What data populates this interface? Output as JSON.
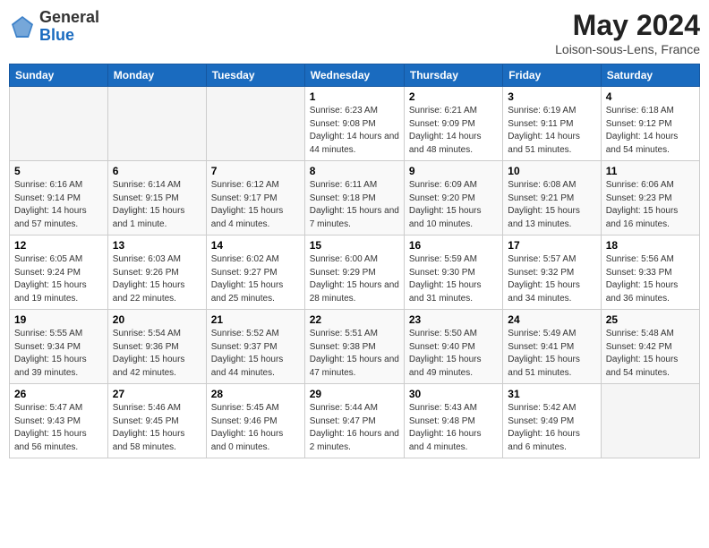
{
  "header": {
    "logo_general": "General",
    "logo_blue": "Blue",
    "month_title": "May 2024",
    "subtitle": "Loison-sous-Lens, France"
  },
  "weekdays": [
    "Sunday",
    "Monday",
    "Tuesday",
    "Wednesday",
    "Thursday",
    "Friday",
    "Saturday"
  ],
  "weeks": [
    [
      {
        "day": "",
        "info": ""
      },
      {
        "day": "",
        "info": ""
      },
      {
        "day": "",
        "info": ""
      },
      {
        "day": "1",
        "info": "Sunrise: 6:23 AM\nSunset: 9:08 PM\nDaylight: 14 hours and 44 minutes."
      },
      {
        "day": "2",
        "info": "Sunrise: 6:21 AM\nSunset: 9:09 PM\nDaylight: 14 hours and 48 minutes."
      },
      {
        "day": "3",
        "info": "Sunrise: 6:19 AM\nSunset: 9:11 PM\nDaylight: 14 hours and 51 minutes."
      },
      {
        "day": "4",
        "info": "Sunrise: 6:18 AM\nSunset: 9:12 PM\nDaylight: 14 hours and 54 minutes."
      }
    ],
    [
      {
        "day": "5",
        "info": "Sunrise: 6:16 AM\nSunset: 9:14 PM\nDaylight: 14 hours and 57 minutes."
      },
      {
        "day": "6",
        "info": "Sunrise: 6:14 AM\nSunset: 9:15 PM\nDaylight: 15 hours and 1 minute."
      },
      {
        "day": "7",
        "info": "Sunrise: 6:12 AM\nSunset: 9:17 PM\nDaylight: 15 hours and 4 minutes."
      },
      {
        "day": "8",
        "info": "Sunrise: 6:11 AM\nSunset: 9:18 PM\nDaylight: 15 hours and 7 minutes."
      },
      {
        "day": "9",
        "info": "Sunrise: 6:09 AM\nSunset: 9:20 PM\nDaylight: 15 hours and 10 minutes."
      },
      {
        "day": "10",
        "info": "Sunrise: 6:08 AM\nSunset: 9:21 PM\nDaylight: 15 hours and 13 minutes."
      },
      {
        "day": "11",
        "info": "Sunrise: 6:06 AM\nSunset: 9:23 PM\nDaylight: 15 hours and 16 minutes."
      }
    ],
    [
      {
        "day": "12",
        "info": "Sunrise: 6:05 AM\nSunset: 9:24 PM\nDaylight: 15 hours and 19 minutes."
      },
      {
        "day": "13",
        "info": "Sunrise: 6:03 AM\nSunset: 9:26 PM\nDaylight: 15 hours and 22 minutes."
      },
      {
        "day": "14",
        "info": "Sunrise: 6:02 AM\nSunset: 9:27 PM\nDaylight: 15 hours and 25 minutes."
      },
      {
        "day": "15",
        "info": "Sunrise: 6:00 AM\nSunset: 9:29 PM\nDaylight: 15 hours and 28 minutes."
      },
      {
        "day": "16",
        "info": "Sunrise: 5:59 AM\nSunset: 9:30 PM\nDaylight: 15 hours and 31 minutes."
      },
      {
        "day": "17",
        "info": "Sunrise: 5:57 AM\nSunset: 9:32 PM\nDaylight: 15 hours and 34 minutes."
      },
      {
        "day": "18",
        "info": "Sunrise: 5:56 AM\nSunset: 9:33 PM\nDaylight: 15 hours and 36 minutes."
      }
    ],
    [
      {
        "day": "19",
        "info": "Sunrise: 5:55 AM\nSunset: 9:34 PM\nDaylight: 15 hours and 39 minutes."
      },
      {
        "day": "20",
        "info": "Sunrise: 5:54 AM\nSunset: 9:36 PM\nDaylight: 15 hours and 42 minutes."
      },
      {
        "day": "21",
        "info": "Sunrise: 5:52 AM\nSunset: 9:37 PM\nDaylight: 15 hours and 44 minutes."
      },
      {
        "day": "22",
        "info": "Sunrise: 5:51 AM\nSunset: 9:38 PM\nDaylight: 15 hours and 47 minutes."
      },
      {
        "day": "23",
        "info": "Sunrise: 5:50 AM\nSunset: 9:40 PM\nDaylight: 15 hours and 49 minutes."
      },
      {
        "day": "24",
        "info": "Sunrise: 5:49 AM\nSunset: 9:41 PM\nDaylight: 15 hours and 51 minutes."
      },
      {
        "day": "25",
        "info": "Sunrise: 5:48 AM\nSunset: 9:42 PM\nDaylight: 15 hours and 54 minutes."
      }
    ],
    [
      {
        "day": "26",
        "info": "Sunrise: 5:47 AM\nSunset: 9:43 PM\nDaylight: 15 hours and 56 minutes."
      },
      {
        "day": "27",
        "info": "Sunrise: 5:46 AM\nSunset: 9:45 PM\nDaylight: 15 hours and 58 minutes."
      },
      {
        "day": "28",
        "info": "Sunrise: 5:45 AM\nSunset: 9:46 PM\nDaylight: 16 hours and 0 minutes."
      },
      {
        "day": "29",
        "info": "Sunrise: 5:44 AM\nSunset: 9:47 PM\nDaylight: 16 hours and 2 minutes."
      },
      {
        "day": "30",
        "info": "Sunrise: 5:43 AM\nSunset: 9:48 PM\nDaylight: 16 hours and 4 minutes."
      },
      {
        "day": "31",
        "info": "Sunrise: 5:42 AM\nSunset: 9:49 PM\nDaylight: 16 hours and 6 minutes."
      },
      {
        "day": "",
        "info": ""
      }
    ]
  ]
}
